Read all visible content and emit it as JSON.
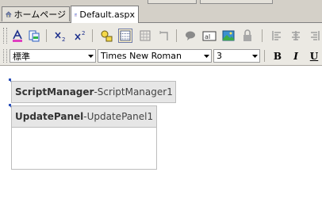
{
  "tabs": [
    {
      "label": "ホームページ",
      "icon": "home-icon",
      "active": false
    },
    {
      "label": "Default.aspx",
      "icon": "aspx-page-icon",
      "active": true
    }
  ],
  "toolbar": {
    "font_block": "標準",
    "font_name": "Times New Roman",
    "font_size": "3",
    "bold_label": "B",
    "italic_label": "I",
    "underline_label": "U"
  },
  "designer": {
    "script_manager": {
      "type": "ScriptManager",
      "separator": " - ",
      "id": "ScriptManager1"
    },
    "update_panel": {
      "type": "UpdatePanel",
      "separator": " - ",
      "id": "UpdatePanel1"
    }
  },
  "colors": {
    "chrome": "#d4d0c8",
    "toolbar": "#ebe9e3",
    "pressed": "#fdf0c4",
    "accent": "#3b61c7"
  }
}
